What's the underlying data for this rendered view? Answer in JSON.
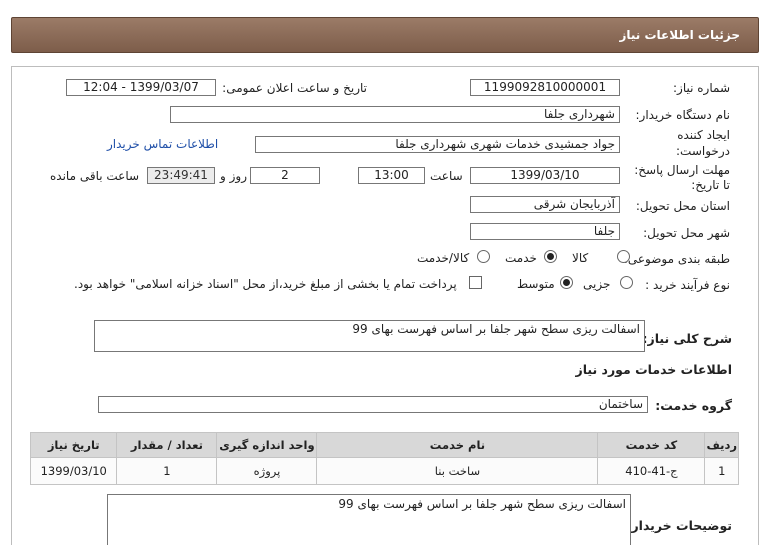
{
  "header": {
    "title": "جزئیات اطلاعات نیاز"
  },
  "fields": {
    "need_number_label": "شماره نیاز:",
    "need_number": "1199092810000001",
    "announce_label": "تاریخ و ساعت اعلان عمومی:",
    "announce_value": "1399/03/07 - 12:04",
    "buyer_org_label": "نام دستگاه خریدار:",
    "buyer_org": "شهرداری جلفا",
    "requester_label_1": "ایجاد کننده",
    "requester_label_2": "درخواست:",
    "requester": "جواد جمشیدی  خدمات شهری  شهرداری جلفا",
    "contact_link": "اطلاعات تماس خریدار",
    "deadline_label_1": "مهلت ارسال پاسخ:",
    "deadline_label_2": "تا تاریخ:",
    "deadline_date": "1399/03/10",
    "time_label": "ساعت",
    "deadline_time": "13:00",
    "days_value": "2",
    "days_label": "روز و",
    "remaining_time": "23:49:41",
    "remaining_label": "ساعت باقی مانده",
    "province_label": "استان محل تحویل:",
    "province": "آذربایجان شرقی",
    "city_label": "شهر محل تحویل:",
    "city": "جلفا",
    "category_label": "طبقه بندی موضوعی:",
    "category_options": [
      "کالا",
      "خدمت",
      "کالا/خدمت"
    ],
    "category_selected": "خدمت",
    "process_label": "نوع فرآیند خرید :",
    "process_options": [
      "جزیی",
      "متوسط"
    ],
    "process_selected": "متوسط",
    "payment_note": "پرداخت تمام یا بخشی از مبلغ خرید،از محل \"اسناد خزانه اسلامی\" خواهد بود."
  },
  "summary": {
    "label": "شرح کلی نیاز:",
    "text": "اسفالت ریزی سطح شهر جلفا بر اساس فهرست بهای 99"
  },
  "services": {
    "section_title": "اطلاعات خدمات مورد نیاز",
    "group_label": "گروه خدمت:",
    "group_value": "ساختمان",
    "columns": [
      "ردیف",
      "کد خدمت",
      "نام خدمت",
      "واحد اندازه گیری",
      "تعداد / مقدار",
      "تاریخ نیاز"
    ],
    "rows": [
      [
        "1",
        "ج-41-410",
        "ساخت بنا",
        "پروژه",
        "1",
        "1399/03/10"
      ]
    ]
  },
  "buyer_notes": {
    "label": "توضیحات خریدار:",
    "text": "اسفالت ریزی سطح شهر جلفا بر اساس فهرست بهای 99"
  }
}
